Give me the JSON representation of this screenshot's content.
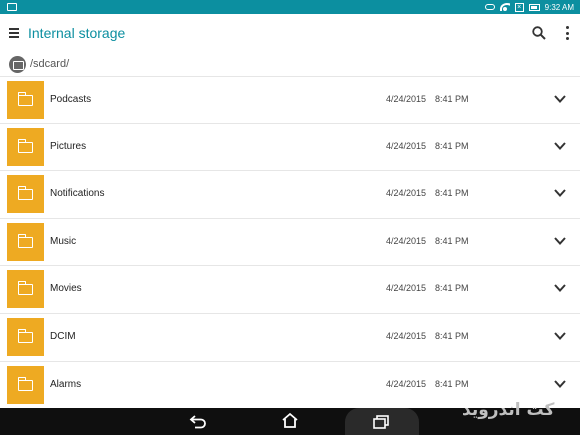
{
  "status_bar": {
    "time": "9:32 AM",
    "icons": [
      "notification-icon",
      "key-icon",
      "wifi-icon",
      "sim-icon",
      "battery-icon"
    ]
  },
  "app_bar": {
    "title": "Internal storage",
    "icons": [
      "menu-icon",
      "search-icon",
      "overflow-menu-icon"
    ]
  },
  "path_bar": {
    "path": "/sdcard/"
  },
  "folders": [
    {
      "name": "Podcasts",
      "date": "4/24/2015",
      "time": "8:41 PM"
    },
    {
      "name": "Pictures",
      "date": "4/24/2015",
      "time": "8:41 PM"
    },
    {
      "name": "Notifications",
      "date": "4/24/2015",
      "time": "8:41 PM"
    },
    {
      "name": "Music",
      "date": "4/24/2015",
      "time": "8:41 PM"
    },
    {
      "name": "Movies",
      "date": "4/24/2015",
      "time": "8:41 PM"
    },
    {
      "name": "DCIM",
      "date": "4/24/2015",
      "time": "8:41 PM"
    },
    {
      "name": "Alarms",
      "date": "4/24/2015",
      "time": "8:41 PM"
    }
  ],
  "nav_bar": {
    "icons": [
      "back-icon",
      "home-icon",
      "recent-apps-icon"
    ]
  },
  "watermark": "کت اندروید",
  "colors": {
    "accent": "#0c8fa0",
    "folder": "#eeaa22",
    "nav_bar": "#0f0f0f"
  }
}
